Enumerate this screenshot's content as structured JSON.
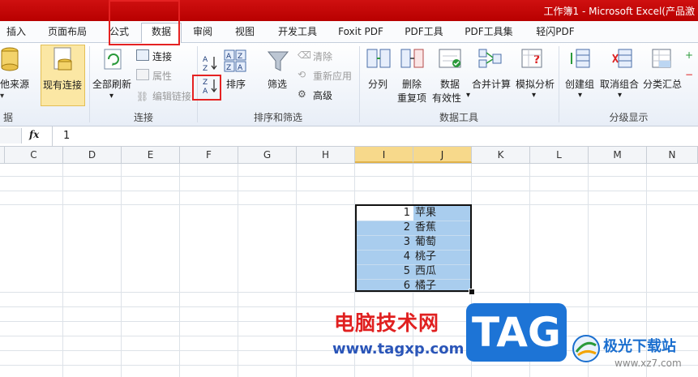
{
  "window": {
    "title": "工作簿1 - Microsoft Excel(产品激"
  },
  "tabs": [
    "插入",
    "页面布局",
    "公式",
    "数据",
    "审阅",
    "视图",
    "开发工具",
    "Foxit PDF",
    "PDF工具",
    "PDF工具集",
    "轻闪PDF"
  ],
  "active_tab": "数据",
  "ribbon": {
    "groups": {
      "get_data": "据",
      "connections": "连接",
      "sort_filter": "排序和筛选",
      "data_tools": "数据工具",
      "outline": "分级显示"
    },
    "buttons": {
      "other_sources": "他来源",
      "existing_connections": "现有连接",
      "refresh_all": "全部刷新",
      "connections": "连接",
      "properties": "属性",
      "edit_links": "编辑链接",
      "sort": "排序",
      "filter": "筛选",
      "clear": "清除",
      "reapply": "重新应用",
      "advanced": "高级",
      "text_to_columns": "分列",
      "remove_duplicates_1": "删除",
      "remove_duplicates_2": "重复项",
      "data_validation_1": "数据",
      "data_validation_2": "有效性",
      "consolidate": "合并计算",
      "what_if": "模拟分析",
      "group": "创建组",
      "ungroup": "取消组合",
      "subtotal": "分类汇总"
    }
  },
  "formula_bar": {
    "fx": "fx",
    "value": "1"
  },
  "columns": [
    "C",
    "D",
    "E",
    "F",
    "G",
    "H",
    "I",
    "J",
    "K",
    "L",
    "M",
    "N"
  ],
  "selected_columns": [
    "I",
    "J"
  ],
  "cells": [
    {
      "num": "1",
      "text": "苹果"
    },
    {
      "num": "2",
      "text": "香蕉"
    },
    {
      "num": "3",
      "text": "葡萄"
    },
    {
      "num": "4",
      "text": "桃子"
    },
    {
      "num": "5",
      "text": "西瓜"
    },
    {
      "num": "6",
      "text": "橘子"
    }
  ],
  "watermark": {
    "site_cn": "电脑技术网",
    "site_url": "www.tagxp.com",
    "badge": "TAG",
    "brand": "极光下载站",
    "brand_url": "www.xz7.com"
  }
}
